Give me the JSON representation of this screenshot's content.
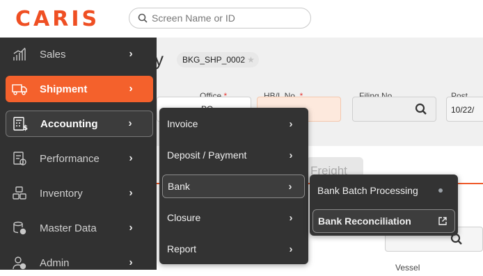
{
  "app": {
    "logo": "CARIS"
  },
  "search": {
    "placeholder": "Screen Name or ID",
    "icon": "search-icon"
  },
  "page": {
    "title_fragment": "y",
    "reference": "BKG_SHP_0002",
    "fields": {
      "office": {
        "label": "Office",
        "required": "*",
        "value": "PO"
      },
      "hbl": {
        "label": "HB/L No.",
        "required": "*",
        "value": ""
      },
      "filing": {
        "label": "Filing No.",
        "value": ""
      },
      "post_date": {
        "label": "Post Dat",
        "value": "10/22/"
      }
    },
    "tab_fragment": "Freight",
    "vessel_label": "Vessel"
  },
  "sidebar": {
    "items": [
      {
        "label": "Sales",
        "icon": "sales-chart-icon"
      },
      {
        "label": "Shipment",
        "icon": "truck-icon"
      },
      {
        "label": "Accounting",
        "icon": "calculator-icon"
      },
      {
        "label": "Performance",
        "icon": "document-chart-icon"
      },
      {
        "label": "Inventory",
        "icon": "boxes-icon"
      },
      {
        "label": "Master Data",
        "icon": "database-gear-icon"
      },
      {
        "label": "Admin",
        "icon": "user-gear-icon"
      }
    ]
  },
  "submenu": {
    "items": [
      {
        "label": "Invoice"
      },
      {
        "label": "Deposit / Payment"
      },
      {
        "label": "Bank"
      },
      {
        "label": "Closure"
      },
      {
        "label": "Report"
      }
    ]
  },
  "submenu2": {
    "items": [
      {
        "label": "Bank Batch Processing"
      },
      {
        "label": "Bank Reconciliation"
      }
    ]
  },
  "colors": {
    "brand": "#ef4f23",
    "active": "#f4612c",
    "sidebar": "#313131"
  }
}
